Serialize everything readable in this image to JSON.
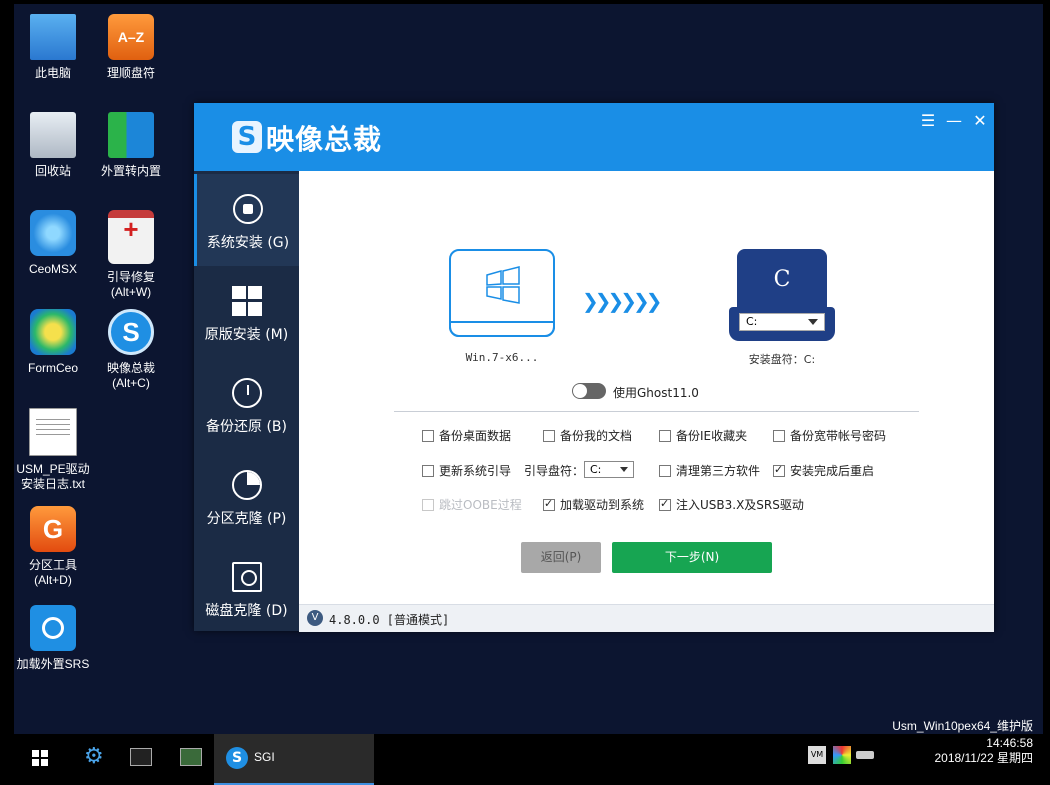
{
  "desktop": {
    "icons": [
      {
        "label": "此电脑"
      },
      {
        "label": "理顺盘符",
        "glyph": "A–Z"
      },
      {
        "label": "回收站"
      },
      {
        "label": "外置转内置"
      },
      {
        "label": "CeoMSX"
      },
      {
        "label": "引导修复\n(Alt+W)"
      },
      {
        "label": "FormCeo"
      },
      {
        "label": "映像总裁\n(Alt+C)",
        "glyph": "S"
      },
      {
        "label": "USM_PE驱动\n安装日志.txt"
      },
      {
        "label": "分区工具\n(Alt+D)",
        "glyph": "G"
      },
      {
        "label": "加载外置SRS"
      }
    ],
    "os_label": "Usm_Win10pex64_维护版"
  },
  "window": {
    "title": "映像总裁",
    "logo_glyph": "S",
    "controls": {
      "menu": "☰",
      "minimize": "—",
      "close": "✕"
    },
    "sidebar": [
      {
        "label": "系统安装 (G)",
        "icon": "disc-install-icon",
        "active": true
      },
      {
        "label": "原版安装 (M)",
        "icon": "windows-icon",
        "active": false
      },
      {
        "label": "备份还原 (B)",
        "icon": "restore-clock-icon",
        "active": false
      },
      {
        "label": "分区克隆 (P)",
        "icon": "pie-icon",
        "active": false
      },
      {
        "label": "磁盘克隆 (D)",
        "icon": "disk-icon",
        "active": false
      }
    ],
    "source": {
      "label": "Win.7-x6..."
    },
    "arrows": "❯❯❯❯❯❯",
    "target": {
      "letter": "C",
      "selected_drive": "C:",
      "label": "安装盘符：C:"
    },
    "ghost_toggle": {
      "label": "使用Ghost11.0",
      "on": false
    },
    "options": {
      "backup_desktop": {
        "label": "备份桌面数据",
        "checked": false
      },
      "backup_docs": {
        "label": "备份我的文档",
        "checked": false
      },
      "backup_ie": {
        "label": "备份IE收藏夹",
        "checked": false
      },
      "backup_broadband": {
        "label": "备份宽带帐号密码",
        "checked": false
      },
      "update_boot": {
        "label": "更新系统引导",
        "checked": false
      },
      "boot_drive_label": "引导盘符：",
      "boot_drive_value": "C:",
      "clean_third_party": {
        "label": "清理第三方软件",
        "checked": false
      },
      "restart_after": {
        "label": "安装完成后重启",
        "checked": true
      },
      "skip_oobe": {
        "label": "跳过OOBE过程",
        "checked": false,
        "disabled": true
      },
      "load_drivers": {
        "label": "加载驱动到系统",
        "checked": true
      },
      "inject_usb3": {
        "label": "注入USB3.X及SRS驱动",
        "checked": true
      }
    },
    "buttons": {
      "back": "返回(P)",
      "next": "下一步(N)"
    },
    "status": {
      "badge": "V",
      "version": "4.8.0.0 [普通模式]"
    }
  },
  "taskbar": {
    "app_label": "SGI",
    "app_glyph": "S",
    "tray_vm": "VM",
    "time": "14:46:58",
    "date": "2018/11/22 星期四"
  },
  "colors": {
    "accent": "#1a8ee6",
    "sidebar": "#1b2b45",
    "next_button": "#17a552",
    "desktop": "#0c1530"
  }
}
